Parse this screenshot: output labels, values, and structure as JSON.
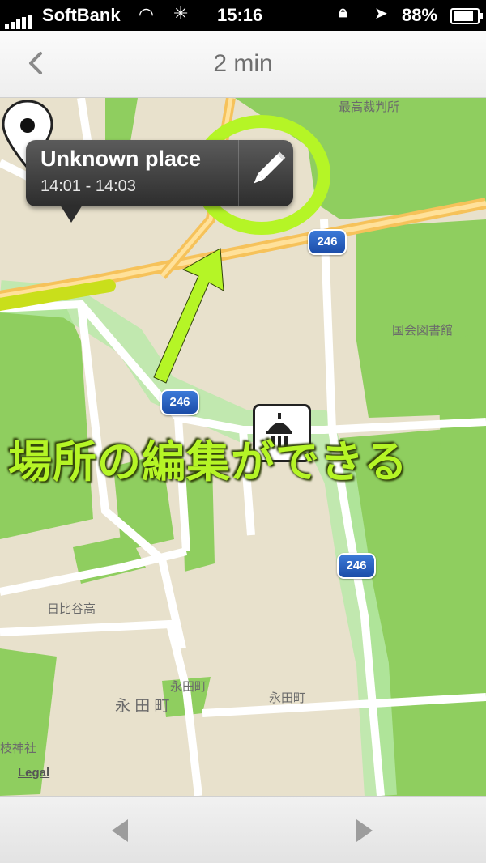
{
  "status_bar": {
    "carrier": "SoftBank",
    "time": "15:16",
    "battery": "88%"
  },
  "nav": {
    "title": "2 min",
    "back_icon": "chevron-left-icon"
  },
  "callout": {
    "name": "Unknown place",
    "times": "14:01 - 14:03",
    "edit_icon": "pencil-icon"
  },
  "annotation": {
    "text": "場所の編集ができる",
    "color": "#b5f526"
  },
  "map": {
    "labels": {
      "supreme_court": "最高裁判所",
      "national_diet_library": "国会図書館",
      "hibiya_high": "日比谷高",
      "nagatacho_1": "永田町",
      "nagatacho_2": "永田町",
      "nagatacho_district": "永 田 町",
      "shrine": "枝神社"
    },
    "route_numbers": [
      "246",
      "246",
      "246"
    ],
    "legal": "Legal"
  },
  "bottom_bar": {
    "prev_icon": "triangle-left-icon",
    "next_icon": "triangle-right-icon"
  }
}
